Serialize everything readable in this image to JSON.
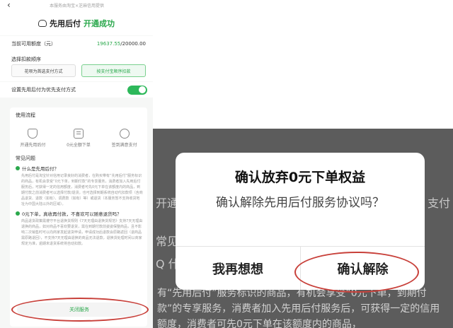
{
  "header": {
    "back_icon": "‹",
    "provider_text": "本服务由淘宝×芝麻信用提供",
    "title": "先用后付",
    "status": "开通成功"
  },
  "quota": {
    "label": "当前可用额度（元）",
    "current": "19637.55",
    "total": "/20000.00"
  },
  "deduct_order": {
    "label": "选择扣款顺序",
    "option_1": "花呗为首选支付方式",
    "option_2": "按支付宝顺序扣款"
  },
  "preferred_payment": {
    "label": "设置先用后付为优先支付方式",
    "enabled": true
  },
  "usage_flow": {
    "title": "使用流程",
    "steps": [
      "开通先用后付",
      "0元全额下单",
      "签到满意支付"
    ]
  },
  "faq": {
    "title": "常见问题",
    "q1": "什么是先用后付？",
    "a1": "先用后付是淘宝针对信用记录良好的消费者，在购买带有“先用后付”服务标识的商品，有机会享受“0元下单，到期付款”的专享服务，消费者加入先用后付服务后，可获得一定的信用额度，消费者可先0元下单在该额度内的商品，到期付款之前消费者可以选择付款/退货，也可选择到期系统自动代扣款项（含商品退货、退款（如有）、调费款（如有）等）或退货（本服务暂不支持收货地址为中国大陆以外的区域）。",
    "q2": "0元下单，真收再付款，不喜欢可以随意退货吗？",
    "a2": "商品退货政策需遵守平台退换货规则《7天无理由退换货规范》支持7天无理由退换的商品，如对商品不喜欢要退货，需在到期付款前姿姿保整商品，且不影响二次销售时可以向商家发起退货申请，申请成功后退款会原路返回（退商品需原路退回），不支持7天无理由退换的商品无法退款，退换货处理时间以商家规定为准，逾期未退货系统将自动扣款。"
  },
  "close_button": "关闭服务",
  "zoom_background": {
    "icon_glyph": "⌒",
    "left_word": "开通",
    "right_word": "支付",
    "section_word": "常见",
    "bullet": "Q 什",
    "paragraph": "有“先用后付”服务标识的商品，有机会享受“0元下单，到期付款”的专享服务，消费者加入先用后付服务后，可获得一定的信用额度，消费者可先0元下单在该额度内的商品，"
  },
  "dialog": {
    "title": "确认放弃0元下单权益",
    "message": "确认解除先用后付服务协议吗？",
    "cancel_label": "我再想想",
    "confirm_label": "确认解除"
  },
  "colors": {
    "brand_green": "#2aa84c",
    "annotation_red": "#c8403a"
  }
}
